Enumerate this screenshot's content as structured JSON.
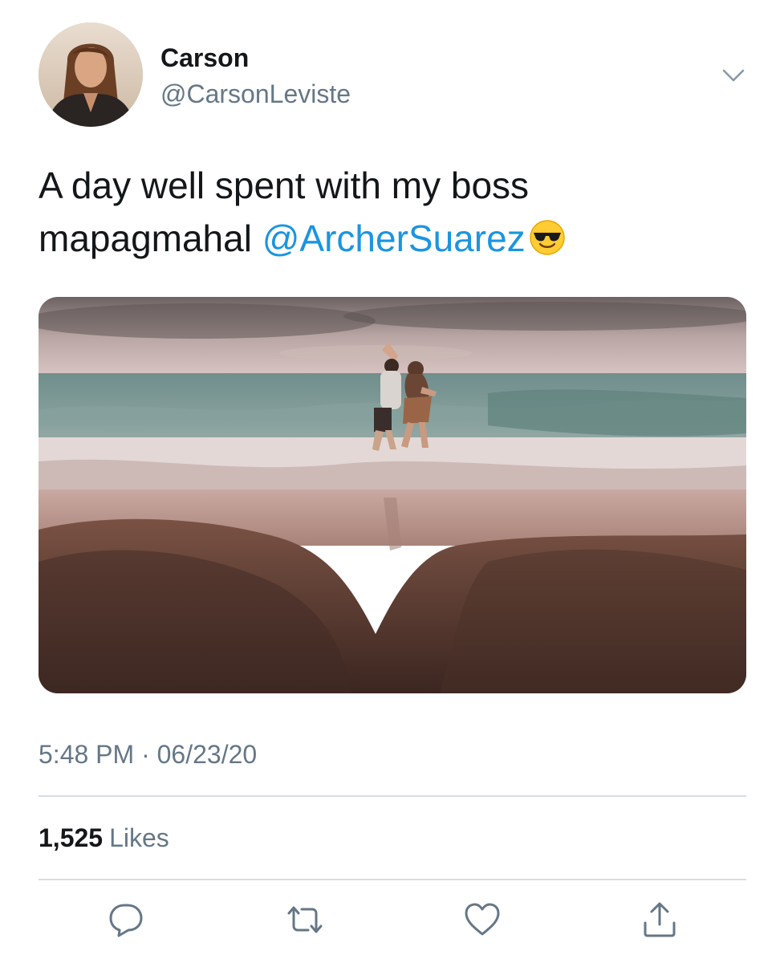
{
  "tweet": {
    "display_name": "Carson",
    "handle": "@CarsonLeviste",
    "text_line1": "A day well spent with my boss",
    "text_line2_prefix": "mapagmahal ",
    "mention": "@ArcherSuarez",
    "emoji": "smiling-face-with-sunglasses",
    "timestamp": "5:48 PM · 06/23/20",
    "likes_count": "1,525",
    "likes_label": "Likes"
  },
  "icons": {
    "menu": "chevron-down-icon",
    "reply": "reply-icon",
    "retweet": "retweet-icon",
    "like": "heart-icon",
    "share": "share-icon"
  },
  "colors": {
    "text": "#14171a",
    "secondary": "#657786",
    "link": "#1b95e0",
    "divider": "#d6dde3",
    "icon": "#657786"
  }
}
